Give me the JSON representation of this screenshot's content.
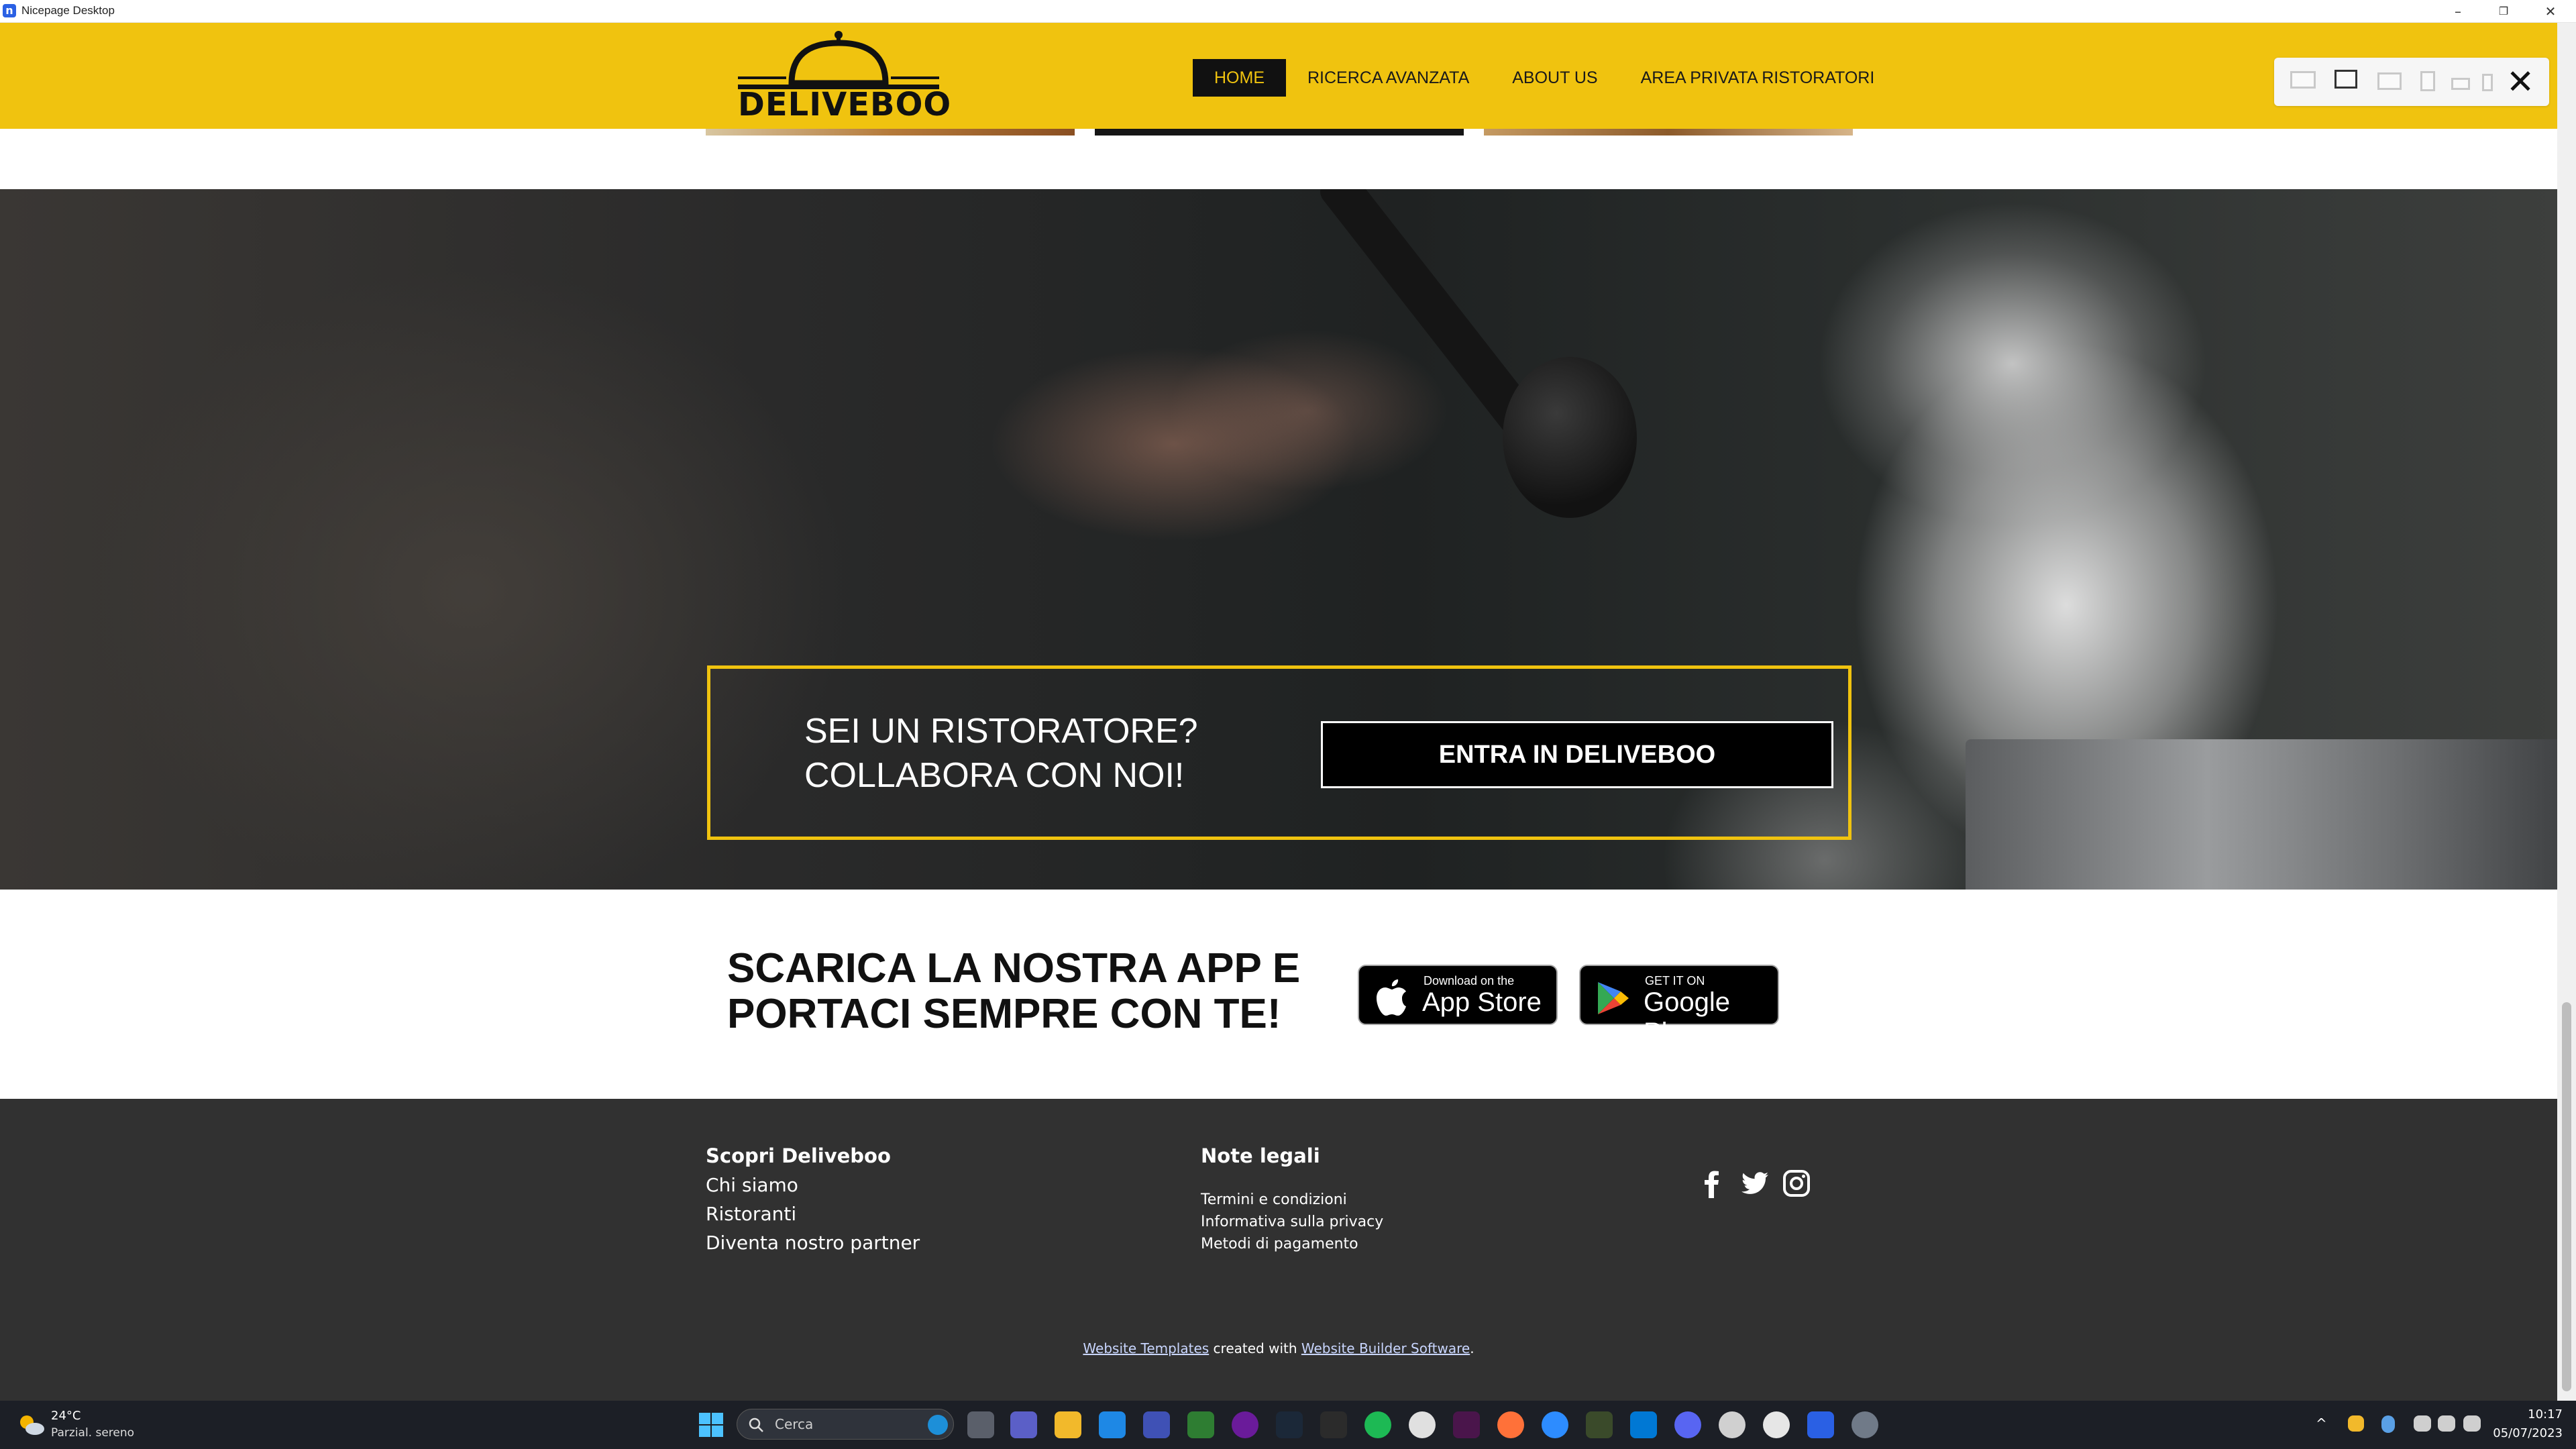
{
  "window": {
    "title": "Nicepage Desktop",
    "controls": [
      "minimize",
      "restore",
      "close"
    ]
  },
  "header": {
    "logo_text": "DELIVEBOO",
    "nav": [
      {
        "label": "HOME",
        "active": true
      },
      {
        "label": "RICERCA AVANZATA",
        "active": false
      },
      {
        "label": "ABOUT US",
        "active": false
      },
      {
        "label": "AREA PRIVATA RISTORATORI",
        "active": false
      }
    ],
    "brand_color": "#f0c30f"
  },
  "device_toolbar": {
    "icons": [
      "desktop-wide-icon",
      "desktop-icon",
      "tablet-landscape-icon",
      "tablet-portrait-icon",
      "phone-landscape-icon",
      "phone-portrait-icon",
      "close-icon"
    ]
  },
  "hero": {
    "cta_line1": "SEI UN RISTORATORE?",
    "cta_line2": "COLLABORA CON NOI!",
    "cta_button": "ENTRA IN DELIVEBOO"
  },
  "app_section": {
    "title_line1": "SCARICA LA NOSTRA APP E",
    "title_line2": "PORTACI SEMPRE CON TE!",
    "app_store_small": "Download on the",
    "app_store_big": "App Store",
    "google_play_small": "GET IT ON",
    "google_play_big": "Google Play"
  },
  "footer": {
    "col1_title": "Scopri Deliveboo",
    "col1_links": [
      "Chi siamo",
      "Ristoranti",
      "Diventa nostro partner"
    ],
    "col2_title": "Note legali",
    "col2_links": [
      "Termini e condizioni",
      "Informativa sulla privacy",
      "Metodi di pagamento"
    ],
    "social": [
      "facebook-icon",
      "twitter-icon",
      "instagram-icon"
    ],
    "credit_link1": "Website Templates",
    "credit_mid": " created with ",
    "credit_link2": "Website Builder Software",
    "credit_end": "."
  },
  "taskbar": {
    "weather_temp": "24°C",
    "weather_desc": "Parzial. sereno",
    "search_placeholder": "Cerca",
    "time": "10:17",
    "date": "05/07/2023"
  }
}
